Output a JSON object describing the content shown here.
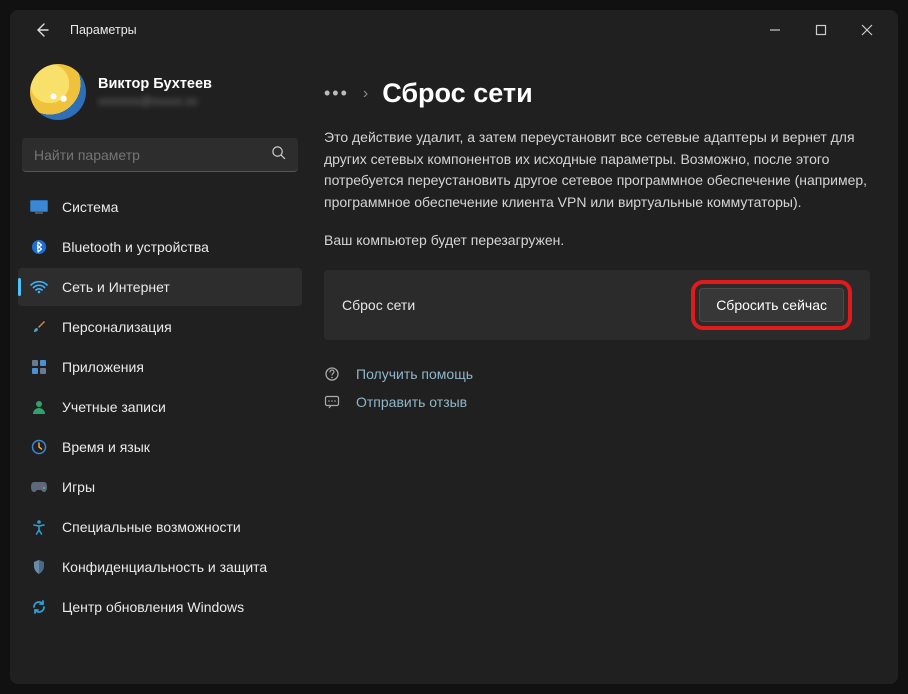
{
  "titlebar": {
    "title": "Параметры"
  },
  "profile": {
    "name": "Виктор Бухтеев",
    "email": "xxxxxxx@xxxxx.xx"
  },
  "search": {
    "placeholder": "Найти параметр"
  },
  "nav": {
    "system": "Система",
    "bluetooth": "Bluetooth и устройства",
    "network": "Сеть и Интернет",
    "personalization": "Персонализация",
    "apps": "Приложения",
    "accounts": "Учетные записи",
    "time": "Время и язык",
    "gaming": "Игры",
    "accessibility": "Специальные возможности",
    "privacy": "Конфиденциальность и защита",
    "update": "Центр обновления Windows"
  },
  "main": {
    "breadcrumb_ellipsis": "•••",
    "breadcrumb_sep": "›",
    "page_title": "Сброс сети",
    "description": "Это действие удалит, а затем переустановит все сетевые адаптеры и вернет для других сетевых компонентов их исходные параметры. Возможно, после этого потребуется переустановить другое сетевое программное обеспечение (например, программное обеспечение клиента VPN или виртуальные коммутаторы).",
    "note": "Ваш компьютер будет перезагружен.",
    "card_label": "Сброс сети",
    "reset_button": "Сбросить сейчас",
    "help_link": "Получить помощь",
    "feedback_link": "Отправить отзыв"
  }
}
